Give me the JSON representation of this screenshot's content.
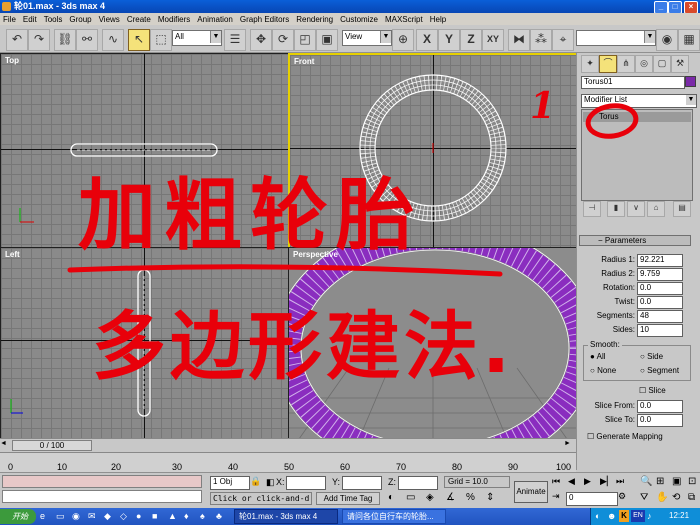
{
  "window": {
    "title": "轮01.max - 3ds max 4",
    "min": "_",
    "max": "□",
    "close": "×"
  },
  "menu": [
    "File",
    "Edit",
    "Tools",
    "Group",
    "Views",
    "Create",
    "Modifiers",
    "Animation",
    "Graph Editors",
    "Rendering",
    "Customize",
    "MAXScript",
    "Help"
  ],
  "toolbar": {
    "selection_filter": "All",
    "ref_coord": "View",
    "axis_x": "X",
    "axis_y": "Y",
    "axis_z": "Z",
    "axis_xy": "XY",
    "named_sel": ""
  },
  "viewports": {
    "top": "Top",
    "front": "Front",
    "left": "Left",
    "perspective": "Perspective"
  },
  "panel": {
    "object_name": "Torus01",
    "modifier_list": "Modifier List",
    "stack_item": "Torus",
    "rollout_title": "Parameters",
    "params": [
      {
        "label": "Radius 1:",
        "value": "92.221"
      },
      {
        "label": "Radius 2:",
        "value": "9.759"
      },
      {
        "label": "Rotation:",
        "value": "0.0"
      },
      {
        "label": "Twist:",
        "value": "0.0"
      },
      {
        "label": "Segments:",
        "value": "48"
      },
      {
        "label": "Sides:",
        "value": "10"
      }
    ],
    "smooth_label": "Smooth:",
    "smooth_all": "All",
    "smooth_side": "Side",
    "smooth_none": "None",
    "smooth_segment": "Segment",
    "slice_label": "Slice",
    "slice_from_label": "Slice From:",
    "slice_from": "0.0",
    "slice_to_label": "Slice To:",
    "slice_to": "0.0",
    "gen_mapping": "Generate Mapping"
  },
  "timeline": {
    "frame": "0 / 100",
    "ticks": [
      "0",
      "10",
      "20",
      "30",
      "40",
      "50",
      "60",
      "70",
      "80",
      "90",
      "100"
    ]
  },
  "status": {
    "selected": "1 Obj",
    "x_label": "X:",
    "y_label": "Y:",
    "z_label": "Z:",
    "grid": "Grid = 10.0",
    "prompt": "Click or click-and-d",
    "add_time_tag": "Add Time Tag",
    "animate": "Animate",
    "frame_field": "0"
  },
  "taskbar": {
    "start": "开始",
    "task1": "轮01.max - 3ds max 4",
    "task2": "请问各位自行车的轮胎...",
    "lang": "EN",
    "clock": "12:21"
  },
  "annotation": {
    "line1": "加粗轮胎",
    "line2": "多边形建法.",
    "number": "1"
  },
  "colors": {
    "active_viewport": "#e6d000",
    "torus_shaded": "#8a2dbf",
    "annotation": "#e8000a",
    "object_swatch": "#7a2aa8"
  }
}
